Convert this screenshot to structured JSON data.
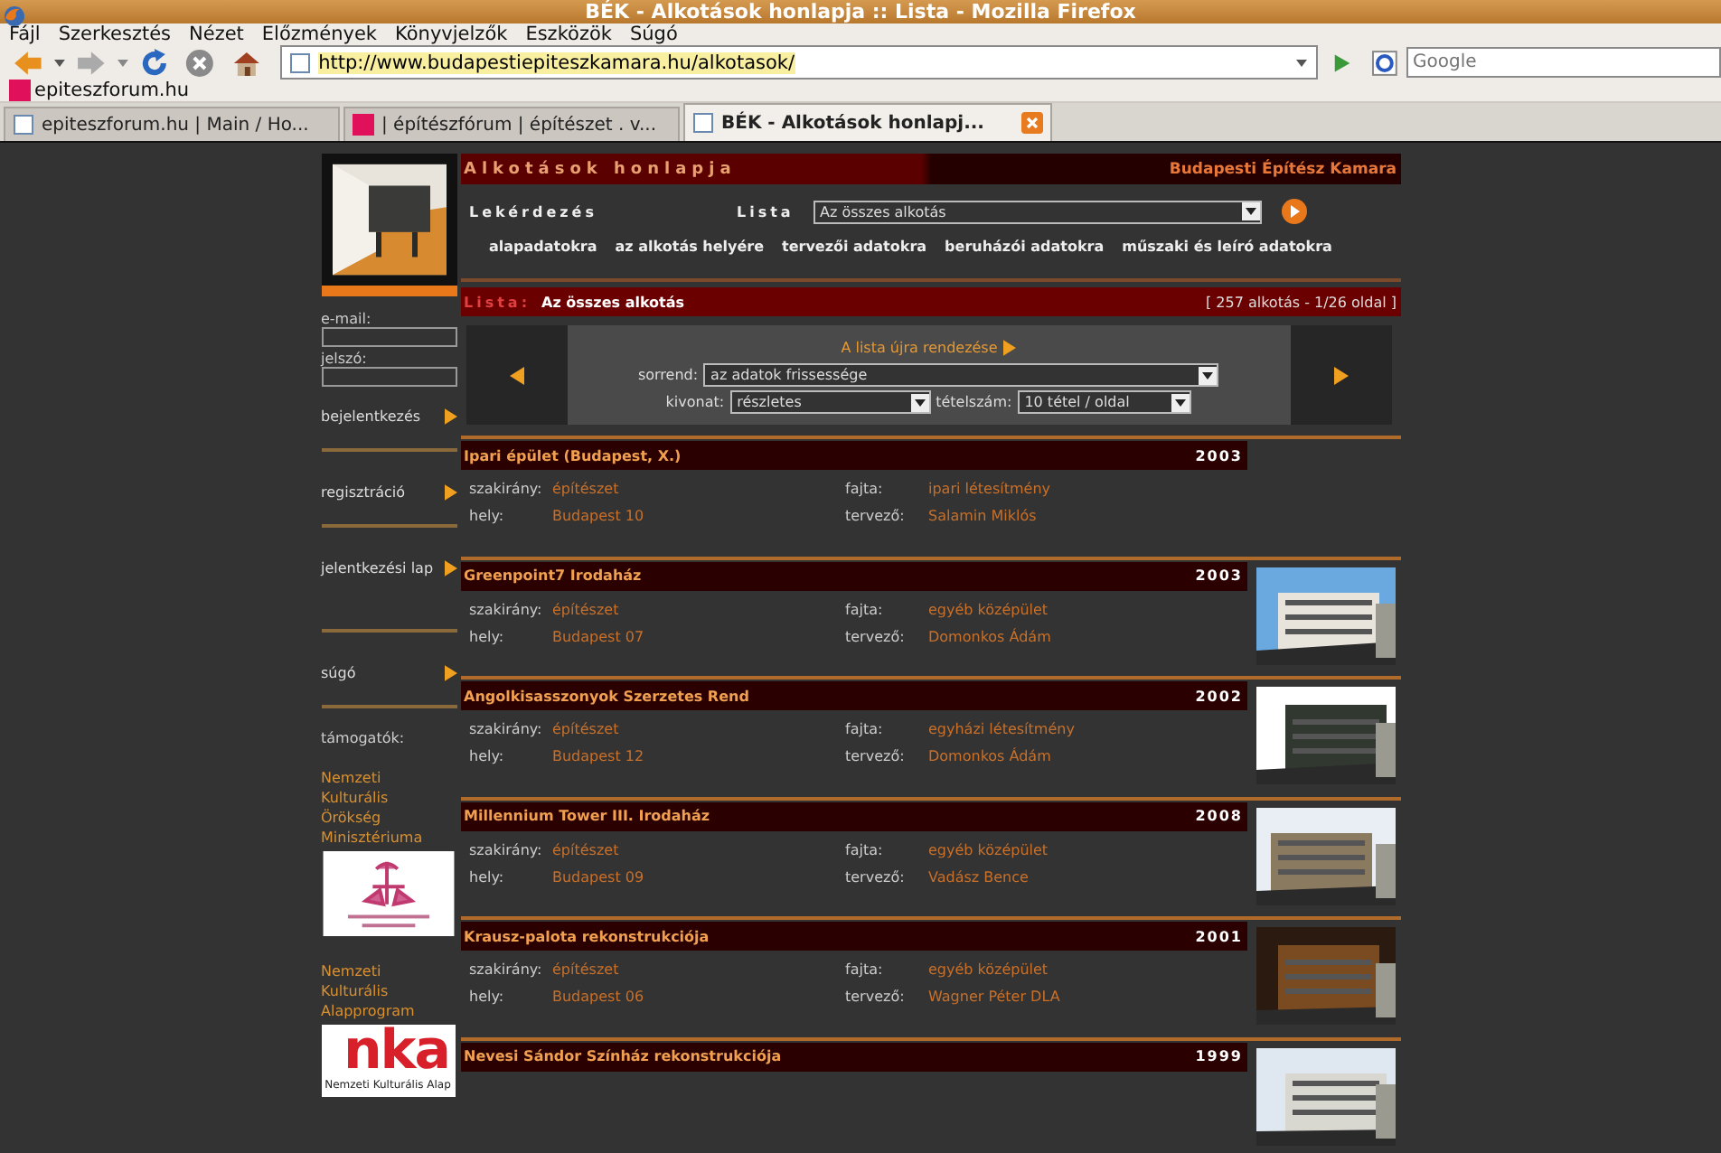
{
  "window": {
    "title": "BÉK - Alkotások honlapja :: Lista - Mozilla Firefox"
  },
  "menu": [
    "Fájl",
    "Szerkesztés",
    "Nézet",
    "Előzmények",
    "Könyvjelzők",
    "Eszközök",
    "Súgó"
  ],
  "url": "http://www.budapestiepiteszkamara.hu/alkotasok/",
  "search": {
    "placeholder": "Google"
  },
  "bookmarks": [
    {
      "label": "epiteszforum.hu"
    }
  ],
  "tabs": [
    {
      "label": "epiteszforum.hu | Main / Ho...",
      "selected": false,
      "kind": "page"
    },
    {
      "label": "| építészfórum | építészet . v...",
      "selected": false,
      "kind": "site"
    },
    {
      "label": "BÉK - Alkotások honlapj...",
      "selected": true,
      "kind": "page"
    }
  ],
  "site": {
    "title": "Alkotások honlapja",
    "org": "Budapesti Építész Kamara",
    "query_label": "Lekérdezés",
    "list_label": "Lista",
    "list_value": "Az összes alkotás",
    "links": [
      "alapadatokra",
      "az alkotás helyére",
      "tervezői adatokra",
      "beruházói adatokra",
      "műszaki és leíró adatokra"
    ]
  },
  "list_bar": {
    "label": "Lista:",
    "value": "Az összes alkotás",
    "count": "[ 257 alkotás - 1/26 oldal ]"
  },
  "sort": {
    "title": "A lista újra rendezése",
    "order_label": "sorrend:",
    "order_value": "az adatok frissessége",
    "extract_label": "kivonat:",
    "extract_value": "részletes",
    "count_label": "tételszám:",
    "count_value": "10 tétel / oldal"
  },
  "sidebar": {
    "email_label": "e-mail:",
    "password_label": "jelszó:",
    "actions": [
      "bejelentkezés",
      "regisztráció",
      "jelentkezési lap",
      "súgó"
    ],
    "sponsors_label": "támogatók:",
    "sponsors": [
      {
        "name": "Nemzeti Kulturális Örökség Minisztériuma",
        "kind": "emblem"
      },
      {
        "name": "Nemzeti Kulturális Alapprogram",
        "kind": "nka",
        "logo_text": "nka",
        "logo_caption": "Nemzeti Kulturális Alap"
      }
    ]
  },
  "items": [
    {
      "title": "Ipari épület (Budapest, X.)",
      "year": "2003",
      "photo": false,
      "fields": [
        {
          "label": "szakirány:",
          "value": "építészet"
        },
        {
          "label": "fajta:",
          "value": "ipari létesítmény"
        },
        {
          "label": "hely:",
          "value": "Budapest 10"
        },
        {
          "label": "tervező:",
          "value": "Salamin Miklós"
        }
      ]
    },
    {
      "title": "Greenpoint7 Irodaház",
      "year": "2003",
      "photo": true,
      "fields": [
        {
          "label": "szakirány:",
          "value": "építészet"
        },
        {
          "label": "fajta:",
          "value": "egyéb középület"
        },
        {
          "label": "hely:",
          "value": "Budapest 07"
        },
        {
          "label": "tervező:",
          "value": "Domonkos Ádám"
        }
      ]
    },
    {
      "title": "Angolkisasszonyok Szerzetes Rend",
      "year": "2002",
      "photo": true,
      "fields": [
        {
          "label": "szakirány:",
          "value": "építészet"
        },
        {
          "label": "fajta:",
          "value": "egyházi létesítmény"
        },
        {
          "label": "hely:",
          "value": "Budapest 12"
        },
        {
          "label": "tervező:",
          "value": "Domonkos Ádám"
        }
      ]
    },
    {
      "title": "Millennium Tower III. Irodaház",
      "year": "2008",
      "photo": true,
      "fields": [
        {
          "label": "szakirány:",
          "value": "építészet"
        },
        {
          "label": "fajta:",
          "value": "egyéb középület"
        },
        {
          "label": "hely:",
          "value": "Budapest 09"
        },
        {
          "label": "tervező:",
          "value": "Vadász Bence"
        }
      ]
    },
    {
      "title": "Krausz-palota rekonstrukciója",
      "year": "2001",
      "photo": true,
      "fields": [
        {
          "label": "szakirány:",
          "value": "építészet"
        },
        {
          "label": "fajta:",
          "value": "egyéb középület"
        },
        {
          "label": "hely:",
          "value": "Budapest 06"
        },
        {
          "label": "tervező:",
          "value": "Wagner Péter DLA"
        }
      ]
    },
    {
      "title": "Nevesi Sándor Színház rekonstrukciója",
      "year": "1999",
      "photo": true
    }
  ]
}
